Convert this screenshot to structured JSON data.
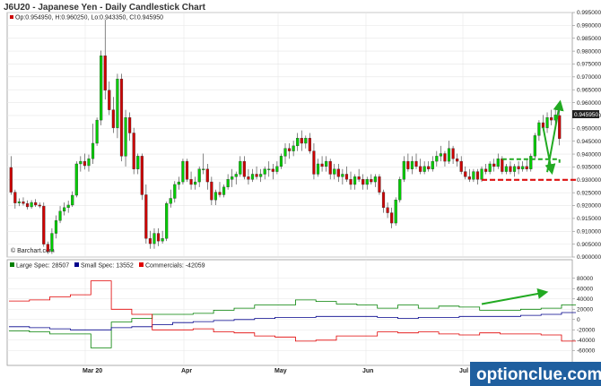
{
  "header": {
    "title": "J6U20 - Japanese Yen - Daily Candlestick Chart",
    "ohlc": "Op:0.954950, H:0.960250, Lo:0.943350, Cl:0.945950",
    "last_price": "0.945950",
    "credit": "© Barchart.com"
  },
  "colors": {
    "up": "#00cc00",
    "down": "#cc0000",
    "large_spec": "#008000",
    "small_spec": "#00008b",
    "commercials": "#e00000",
    "annotation": "#22aa22",
    "annotation_red": "#dd1111",
    "watermark_bg": "#1f5f9f"
  },
  "watermark": {
    "text": "optionclue.com"
  },
  "chart_data": [
    {
      "type": "candlestick",
      "ylim": [
        0.9,
        0.995
      ],
      "y_ticks": [
        "0.995000",
        "0.990000",
        "0.985000",
        "0.980000",
        "0.975000",
        "0.970000",
        "0.965000",
        "0.960000",
        "0.955000",
        "0.950000",
        "0.945000",
        "0.940000",
        "0.935000",
        "0.930000",
        "0.925000",
        "0.920000",
        "0.915000",
        "0.910000",
        "0.905000",
        "0.900000"
      ],
      "x_labels": [
        "Mar 20",
        "Apr",
        "May",
        "Jun",
        "Jul"
      ],
      "ohlc": [
        [
          0.9348,
          0.9392,
          0.9242,
          0.9252
        ],
        [
          0.9252,
          0.9262,
          0.9188,
          0.921
        ],
        [
          0.921,
          0.9228,
          0.9198,
          0.9215
        ],
        [
          0.9215,
          0.9232,
          0.92,
          0.9208
        ],
        [
          0.9208,
          0.922,
          0.9185,
          0.9195
        ],
        [
          0.9195,
          0.9221,
          0.9188,
          0.9212
        ],
        [
          0.9212,
          0.9225,
          0.9195,
          0.9202
        ],
        [
          0.9202,
          0.9212,
          0.919,
          0.9198
        ],
        [
          0.9198,
          0.9212,
          0.904,
          0.905
        ],
        [
          0.905,
          0.906,
          0.9012,
          0.9022
        ],
        [
          0.9022,
          0.9112,
          0.9012,
          0.9092
        ],
        [
          0.9092,
          0.9162,
          0.9072,
          0.9142
        ],
        [
          0.9142,
          0.9198,
          0.9132,
          0.9178
        ],
        [
          0.9178,
          0.9212,
          0.9162,
          0.9192
        ],
        [
          0.9192,
          0.9219,
          0.9172,
          0.9202
        ],
        [
          0.9202,
          0.9255,
          0.9195,
          0.924
        ],
        [
          0.924,
          0.9372,
          0.9232,
          0.9362
        ],
        [
          0.9362,
          0.9392,
          0.9332,
          0.9372
        ],
        [
          0.9372,
          0.9402,
          0.934,
          0.9355
        ],
        [
          0.9355,
          0.9398,
          0.9332,
          0.9382
        ],
        [
          0.9382,
          0.9518,
          0.9362,
          0.9442
        ],
        [
          0.9442,
          0.9542,
          0.9432,
          0.9532
        ],
        [
          0.9532,
          0.9802,
          0.9512,
          0.9782
        ],
        [
          0.9782,
          0.9922,
          0.9612,
          0.9648
        ],
        [
          0.9648,
          0.9682,
          0.9552,
          0.9572
        ],
        [
          0.9572,
          0.9622,
          0.9482,
          0.9502
        ],
        [
          0.9502,
          0.9712,
          0.9462,
          0.9692
        ],
        [
          0.9692,
          0.9712,
          0.9372,
          0.9392
        ],
        [
          0.9392,
          0.9572,
          0.9352,
          0.9542
        ],
        [
          0.9542,
          0.9562,
          0.9452,
          0.9482
        ],
        [
          0.9482,
          0.9502,
          0.9322,
          0.9342
        ],
        [
          0.9342,
          0.9402,
          0.9322,
          0.9392
        ],
        [
          0.9392,
          0.9402,
          0.9222,
          0.9242
        ],
        [
          0.9242,
          0.9282,
          0.9052,
          0.9072
        ],
        [
          0.9072,
          0.9102,
          0.9032,
          0.9052
        ],
        [
          0.9052,
          0.9112,
          0.9032,
          0.9092
        ],
        [
          0.9092,
          0.9112,
          0.9042,
          0.9062
        ],
        [
          0.9062,
          0.9102,
          0.9052,
          0.9072
        ],
        [
          0.9072,
          0.9215,
          0.9062,
          0.9208
        ],
        [
          0.9208,
          0.9262,
          0.9192,
          0.9228
        ],
        [
          0.9228,
          0.9295,
          0.9212,
          0.9282
        ],
        [
          0.9282,
          0.9312,
          0.9262,
          0.9292
        ],
        [
          0.9292,
          0.9382,
          0.9282,
          0.9372
        ],
        [
          0.9372,
          0.9382,
          0.9292,
          0.9302
        ],
        [
          0.9302,
          0.9332,
          0.9262,
          0.9282
        ],
        [
          0.9282,
          0.9312,
          0.9262,
          0.9292
        ],
        [
          0.9292,
          0.9352,
          0.9272,
          0.9342
        ],
        [
          0.9342,
          0.9402,
          0.9322,
          0.9342
        ],
        [
          0.9342,
          0.9362,
          0.9262,
          0.9292
        ],
        [
          0.9292,
          0.9312,
          0.9202,
          0.9222
        ],
        [
          0.9222,
          0.9262,
          0.9202,
          0.9252
        ],
        [
          0.9252,
          0.9292,
          0.9232,
          0.9242
        ],
        [
          0.9242,
          0.9282,
          0.9232,
          0.9272
        ],
        [
          0.9272,
          0.9322,
          0.9262,
          0.9302
        ],
        [
          0.9302,
          0.9342,
          0.9272,
          0.9312
        ],
        [
          0.9312,
          0.9332,
          0.9282,
          0.9322
        ],
        [
          0.9322,
          0.9392,
          0.9312,
          0.9372
        ],
        [
          0.9372,
          0.9392,
          0.9302,
          0.9312
        ],
        [
          0.9312,
          0.9342,
          0.9282,
          0.9302
        ],
        [
          0.9302,
          0.9342,
          0.9292,
          0.9322
        ],
        [
          0.9322,
          0.9352,
          0.9302,
          0.9312
        ],
        [
          0.9312,
          0.9342,
          0.9292,
          0.9322
        ],
        [
          0.9322,
          0.9352,
          0.9302,
          0.9342
        ],
        [
          0.9342,
          0.9372,
          0.9312,
          0.9342
        ],
        [
          0.9342,
          0.9362,
          0.9302,
          0.9332
        ],
        [
          0.9332,
          0.9372,
          0.9322,
          0.9352
        ],
        [
          0.9352,
          0.9402,
          0.9342,
          0.9392
        ],
        [
          0.9392,
          0.9442,
          0.9362,
          0.9422
        ],
        [
          0.9422,
          0.9442,
          0.9382,
          0.9412
        ],
        [
          0.9412,
          0.9452,
          0.9392,
          0.9432
        ],
        [
          0.9432,
          0.9482,
          0.9412,
          0.9462
        ],
        [
          0.9462,
          0.9492,
          0.9412,
          0.9442
        ],
        [
          0.9442,
          0.9472,
          0.9422,
          0.9462
        ],
        [
          0.9462,
          0.9482,
          0.9402,
          0.9412
        ],
        [
          0.9412,
          0.9442,
          0.9302,
          0.9322
        ],
        [
          0.9322,
          0.9382,
          0.9312,
          0.9362
        ],
        [
          0.9362,
          0.9392,
          0.9332,
          0.9352
        ],
        [
          0.9352,
          0.9392,
          0.9332,
          0.9372
        ],
        [
          0.9372,
          0.9382,
          0.9302,
          0.9322
        ],
        [
          0.9322,
          0.9362,
          0.9302,
          0.9342
        ],
        [
          0.9342,
          0.9362,
          0.9292,
          0.9312
        ],
        [
          0.9312,
          0.9342,
          0.9282,
          0.9322
        ],
        [
          0.9322,
          0.9352,
          0.9292,
          0.9302
        ],
        [
          0.9302,
          0.9332,
          0.9262,
          0.9282
        ],
        [
          0.9282,
          0.9322,
          0.9262,
          0.9312
        ],
        [
          0.9312,
          0.9342,
          0.9292,
          0.9302
        ],
        [
          0.9302,
          0.9322,
          0.9262,
          0.9282
        ],
        [
          0.9282,
          0.9312,
          0.9262,
          0.9302
        ],
        [
          0.9302,
          0.9322,
          0.9282,
          0.9292
        ],
        [
          0.9292,
          0.9322,
          0.9272,
          0.9312
        ],
        [
          0.9312,
          0.9322,
          0.9242,
          0.9252
        ],
        [
          0.9252,
          0.9262,
          0.9172,
          0.9192
        ],
        [
          0.9192,
          0.9212,
          0.9152,
          0.9172
        ],
        [
          0.9172,
          0.9192,
          0.9112,
          0.9132
        ],
        [
          0.9132,
          0.9232,
          0.9122,
          0.9222
        ],
        [
          0.9222,
          0.9312,
          0.9212,
          0.9302
        ],
        [
          0.9302,
          0.9392,
          0.9292,
          0.9372
        ],
        [
          0.9372,
          0.9402,
          0.9332,
          0.9342
        ],
        [
          0.9342,
          0.9392,
          0.9322,
          0.9372
        ],
        [
          0.9372,
          0.9402,
          0.9342,
          0.9352
        ],
        [
          0.9352,
          0.9382,
          0.9322,
          0.9332
        ],
        [
          0.9332,
          0.9372,
          0.9322,
          0.9352
        ],
        [
          0.9352,
          0.9372,
          0.9332,
          0.9342
        ],
        [
          0.9342,
          0.9392,
          0.9332,
          0.9372
        ],
        [
          0.9372,
          0.9412,
          0.9352,
          0.9392
        ],
        [
          0.9392,
          0.9432,
          0.9372,
          0.9402
        ],
        [
          0.9402,
          0.9412,
          0.9352,
          0.9372
        ],
        [
          0.9372,
          0.9452,
          0.9362,
          0.9422
        ],
        [
          0.9422,
          0.9432,
          0.9362,
          0.9382
        ],
        [
          0.9382,
          0.9402,
          0.9352,
          0.9372
        ],
        [
          0.9372,
          0.9392,
          0.9322,
          0.9332
        ],
        [
          0.9332,
          0.9352,
          0.9302,
          0.9312
        ],
        [
          0.9312,
          0.9342,
          0.9292,
          0.9302
        ],
        [
          0.9302,
          0.9342,
          0.9292,
          0.9332
        ],
        [
          0.9332,
          0.9342,
          0.9282,
          0.9302
        ],
        [
          0.9302,
          0.9352,
          0.9292,
          0.9342
        ],
        [
          0.9342,
          0.9362,
          0.9322,
          0.9332
        ],
        [
          0.9332,
          0.9372,
          0.9322,
          0.9362
        ],
        [
          0.9362,
          0.9382,
          0.9332,
          0.9352
        ],
        [
          0.9352,
          0.9402,
          0.9342,
          0.9382
        ],
        [
          0.9382,
          0.9392,
          0.9322,
          0.9332
        ],
        [
          0.9332,
          0.9362,
          0.9322,
          0.9352
        ],
        [
          0.9352,
          0.9372,
          0.9322,
          0.9332
        ],
        [
          0.9332,
          0.9362,
          0.9312,
          0.9352
        ],
        [
          0.9352,
          0.9372,
          0.9322,
          0.9342
        ],
        [
          0.9342,
          0.9372,
          0.9332,
          0.9352
        ],
        [
          0.9352,
          0.9382,
          0.9332,
          0.9342
        ],
        [
          0.9342,
          0.9402,
          0.9332,
          0.9392
        ],
        [
          0.9392,
          0.9482,
          0.9382,
          0.9472
        ],
        [
          0.9472,
          0.9532,
          0.9452,
          0.9522
        ],
        [
          0.9522,
          0.9552,
          0.9492,
          0.9502
        ],
        [
          0.9502,
          0.9562,
          0.9482,
          0.9542
        ],
        [
          0.9542,
          0.9572,
          0.9512,
          0.9532
        ],
        [
          0.9532,
          0.9582,
          0.9512,
          0.9552
        ],
        [
          0.955,
          0.9603,
          0.9434,
          0.946
        ]
      ],
      "annotations": {
        "up_arrow": {
          "from": [
            131,
            0.933
          ],
          "to": [
            134,
            0.959
          ]
        },
        "down_arrow": {
          "from": [
            130,
            0.9505
          ],
          "to": [
            132,
            0.934
          ]
        },
        "support_line": {
          "from": [
            115,
            0.93
          ],
          "to": [
            138,
            0.93
          ]
        },
        "resistance_line": {
          "from": [
            120,
            0.938
          ],
          "to": [
            134,
            0.938
          ]
        }
      }
    },
    {
      "type": "line",
      "ylim": [
        -70000,
        90000
      ],
      "y_ticks": [
        "80000",
        "60000",
        "40000",
        "20000",
        "0",
        "-20000",
        "-40000",
        "-60000"
      ],
      "legend": [
        {
          "name": "Large Spec: 28507"
        },
        {
          "name": "Small Spec: 13552"
        },
        {
          "name": "Commercials: -42059"
        }
      ],
      "week_x": [
        0,
        5,
        10,
        15,
        20,
        25,
        30,
        35,
        40,
        45,
        50,
        55,
        60,
        65,
        70,
        75,
        80,
        85,
        90,
        95,
        100,
        105,
        110,
        115,
        120,
        125,
        130,
        135
      ],
      "series": [
        {
          "values": [
            -22000,
            -24000,
            -28000,
            -28000,
            -55000,
            -5000,
            2000,
            10000,
            10000,
            12000,
            18000,
            22000,
            28000,
            28000,
            38000,
            35000,
            30000,
            28000,
            22000,
            28000,
            22000,
            26000,
            24000,
            18000,
            18000,
            20000,
            22000,
            28507
          ]
        },
        {
          "values": [
            -14000,
            -16000,
            -18000,
            -20000,
            -20000,
            -16000,
            -14000,
            -10000,
            -6000,
            -4000,
            -2000,
            0,
            2000,
            4000,
            4000,
            6000,
            6000,
            6000,
            4000,
            2000,
            4000,
            4000,
            6000,
            6000,
            6000,
            8000,
            10000,
            13552
          ]
        },
        {
          "values": [
            36000,
            38000,
            44000,
            48000,
            75000,
            20000,
            10000,
            -20000,
            -20000,
            -18000,
            -24000,
            -26000,
            -32000,
            -34000,
            -42000,
            -40000,
            -32000,
            -32000,
            -24000,
            -26000,
            -24000,
            -28000,
            -30000,
            -26000,
            -28000,
            -28000,
            -30000,
            -42059
          ]
        }
      ],
      "annotations": {
        "up_arrow": {
          "from": [
            115,
            30000
          ],
          "to": [
            130,
            52000
          ]
        }
      }
    }
  ]
}
